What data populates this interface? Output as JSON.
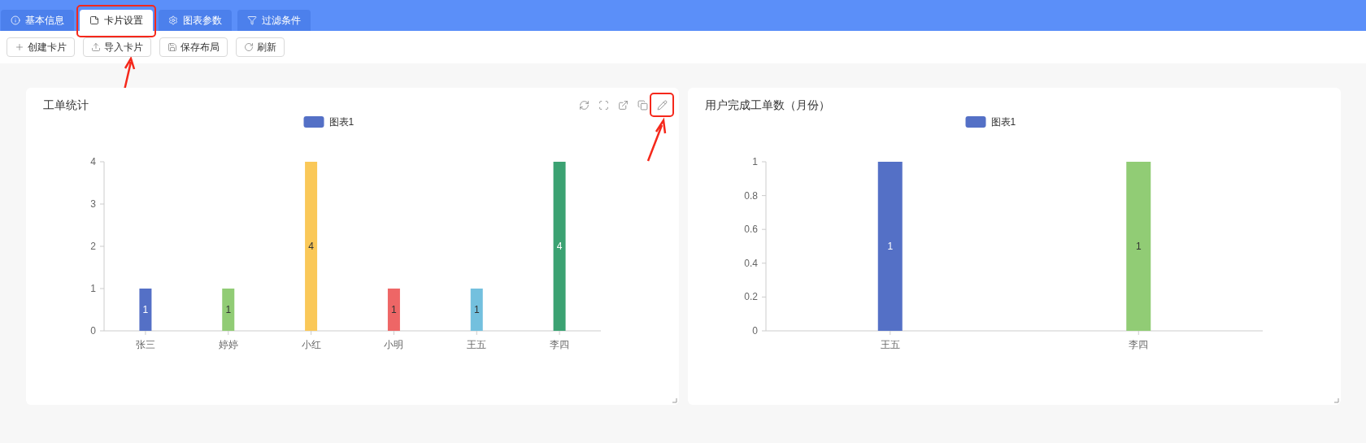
{
  "tabs": [
    {
      "label": "基本信息",
      "selected": false,
      "highlighted": false
    },
    {
      "label": "卡片设置",
      "selected": true,
      "highlighted": true
    },
    {
      "label": "图表参数",
      "selected": false,
      "highlighted": false
    },
    {
      "label": "过滤条件",
      "selected": false,
      "highlighted": false
    }
  ],
  "toolbar": [
    {
      "label": "创建卡片",
      "highlighted": false
    },
    {
      "label": "导入卡片",
      "highlighted": true
    },
    {
      "label": "保存布局",
      "highlighted": false
    },
    {
      "label": "刷新",
      "highlighted": false
    }
  ],
  "cards": [
    {
      "title": "工单统计",
      "tools": [
        {
          "highlighted": false
        },
        {
          "highlighted": false
        },
        {
          "highlighted": false
        },
        {
          "highlighted": false
        },
        {
          "highlighted": true
        }
      ],
      "bars": [
        {
          "color": "#5470c6"
        },
        {
          "color": "#91cc75"
        },
        {
          "color": "#fac858"
        },
        {
          "color": "#ee6666"
        },
        {
          "color": "#73c0de"
        },
        {
          "color": "#3ba272"
        }
      ],
      "chart_data": {
        "type": "bar",
        "categories": [
          "张三",
          "婷婷",
          "小红",
          "小明",
          "王五",
          "李四"
        ],
        "series": [
          {
            "name": "图表1",
            "values": [
              1,
              1,
              4,
              1,
              1,
              4
            ]
          }
        ],
        "ylim": [
          0,
          4
        ],
        "yticks": [
          0,
          1,
          2,
          3,
          4
        ],
        "data_labels": true
      }
    },
    {
      "title": "用户完成工单数（月份）",
      "bars": [
        {
          "color": "#5470c6"
        },
        {
          "color": "#91cc75"
        }
      ],
      "chart_data": {
        "type": "bar",
        "categories": [
          "王五",
          "李四"
        ],
        "series": [
          {
            "name": "图表1",
            "values": [
              1,
              1
            ]
          }
        ],
        "ylim": [
          0,
          1
        ],
        "yticks": [
          0,
          0.2,
          0.4,
          0.6,
          0.8,
          1
        ],
        "data_labels": true
      }
    }
  ]
}
